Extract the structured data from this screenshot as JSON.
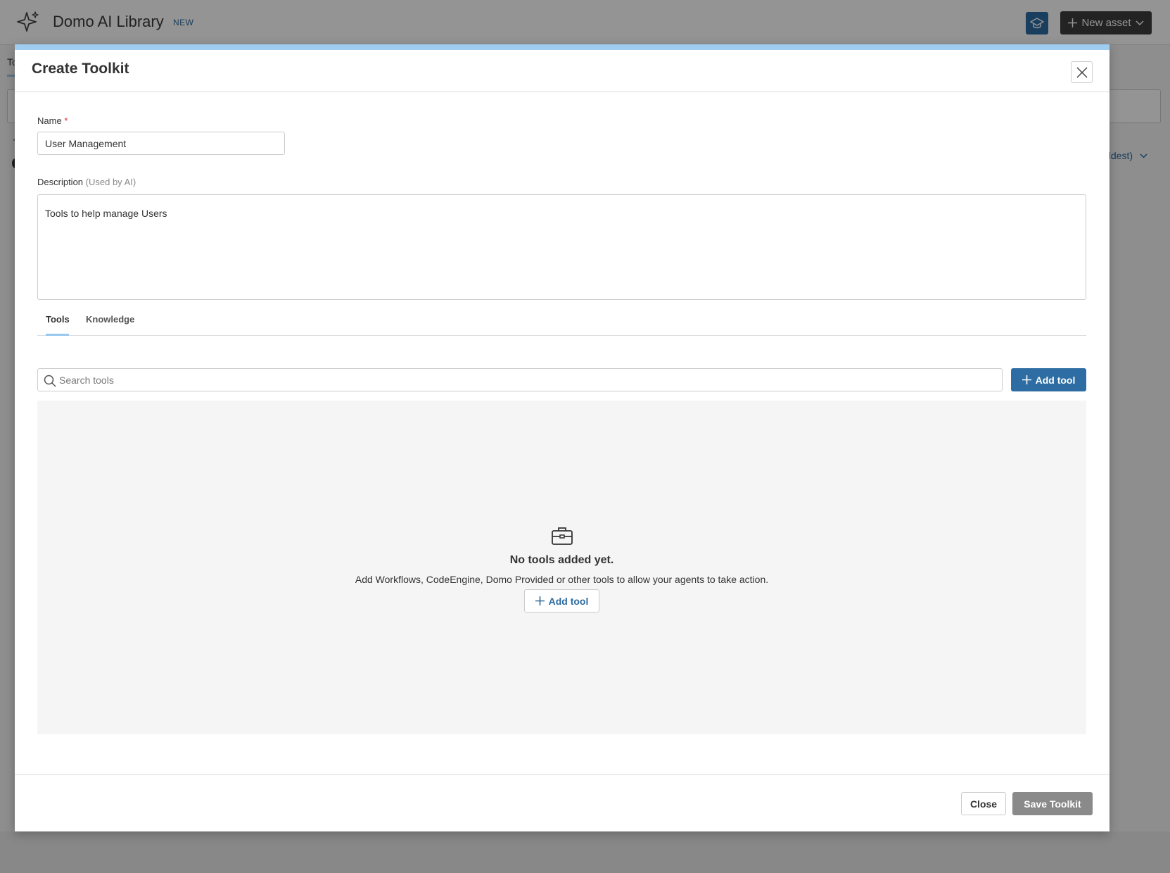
{
  "app": {
    "title": "Domo AI Library",
    "badge": "NEW",
    "new_asset_label": "New asset",
    "bg_tab_label": "To",
    "bg_sort_label": "oldest)",
    "logo_icon": "sparkle-icon",
    "learn_icon": "graduation-cap-icon"
  },
  "modal": {
    "title": "Create Toolkit",
    "name": {
      "label": "Name",
      "required_mark": "*",
      "value": "User Management"
    },
    "description": {
      "label": "Description",
      "hint": "(Used by AI)",
      "value": "Tools to help manage Users"
    },
    "tabs": [
      {
        "label": "Tools",
        "active": true
      },
      {
        "label": "Knowledge",
        "active": false
      }
    ],
    "search": {
      "placeholder": "Search tools"
    },
    "add_tool_label": "Add tool",
    "empty_state": {
      "icon": "toolbox-icon",
      "title": "No tools added yet.",
      "description": "Add Workflows, CodeEngine, Domo Provided or other tools to allow your agents to take action.",
      "button_label": "Add tool"
    },
    "footer": {
      "close_label": "Close",
      "save_label": "Save Toolkit"
    }
  },
  "colors": {
    "primary": "#2d6da3",
    "accent_bar": "#9fcdf0",
    "disabled_button": "#8a8a8a",
    "required": "#dd3333"
  }
}
